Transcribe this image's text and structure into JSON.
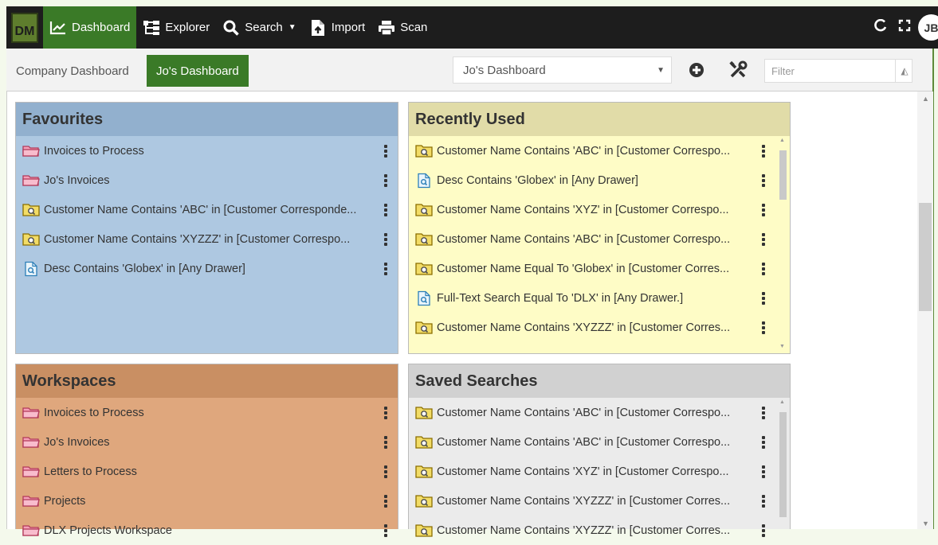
{
  "app": {
    "logo_text": "DM",
    "avatar_initials": "JB"
  },
  "nav": {
    "items": [
      {
        "label": "Dashboard",
        "icon": "line-chart-icon",
        "active": true
      },
      {
        "label": "Explorer",
        "icon": "tree-icon"
      },
      {
        "label": "Search",
        "icon": "search-icon",
        "dropdown": true
      },
      {
        "label": "Import",
        "icon": "file-import-icon"
      },
      {
        "label": "Scan",
        "icon": "printer-icon"
      }
    ],
    "right_icons": [
      "refresh-icon",
      "fullscreen-icon"
    ]
  },
  "toolbar": {
    "tabs": [
      {
        "label": "Company Dashboard",
        "active": false
      },
      {
        "label": "Jo's Dashboard",
        "active": true
      }
    ],
    "dashboard_select": "Jo's Dashboard",
    "filter_placeholder": "Filter"
  },
  "panels": {
    "favourites": {
      "title": "Favourites",
      "items": [
        {
          "type": "folder",
          "label": "Invoices to Process"
        },
        {
          "type": "folder",
          "label": "Jo's Invoices"
        },
        {
          "type": "search",
          "label": "Customer Name Contains 'ABC' in [Customer Corresponde..."
        },
        {
          "type": "search",
          "label": "Customer Name Contains 'XYZZZ' in [Customer Correspo..."
        },
        {
          "type": "doc",
          "label": "Desc Contains 'Globex' in [Any Drawer]"
        }
      ]
    },
    "recent": {
      "title": "Recently Used",
      "items": [
        {
          "type": "search",
          "label": "Customer Name Contains 'ABC' in [Customer Correspo..."
        },
        {
          "type": "doc",
          "label": "Desc Contains 'Globex' in [Any Drawer]"
        },
        {
          "type": "search",
          "label": "Customer Name Contains 'XYZ' in [Customer Correspo..."
        },
        {
          "type": "search",
          "label": "Customer Name Contains 'ABC' in [Customer Correspo..."
        },
        {
          "type": "search",
          "label": "Customer Name Equal To 'Globex' in [Customer Corres..."
        },
        {
          "type": "doc",
          "label": "Full-Text Search Equal To 'DLX' in [Any Drawer.]"
        },
        {
          "type": "search",
          "label": "Customer Name Contains 'XYZZZ' in [Customer Corres..."
        }
      ]
    },
    "workspaces": {
      "title": "Workspaces",
      "items": [
        {
          "type": "folder",
          "label": "Invoices to Process"
        },
        {
          "type": "folder",
          "label": "Jo's Invoices"
        },
        {
          "type": "folder",
          "label": "Letters to Process"
        },
        {
          "type": "folder",
          "label": "Projects"
        },
        {
          "type": "folder",
          "label": "DLX Projects Workspace"
        }
      ]
    },
    "saved": {
      "title": "Saved Searches",
      "items": [
        {
          "type": "search",
          "label": "Customer Name Contains 'ABC' in [Customer Correspo..."
        },
        {
          "type": "search",
          "label": "Customer Name Contains 'ABC' in [Customer Correspo..."
        },
        {
          "type": "search",
          "label": "Customer Name Contains 'XYZ' in [Customer Correspo..."
        },
        {
          "type": "search",
          "label": "Customer Name Contains 'XYZZZ' in [Customer Corres..."
        },
        {
          "type": "search",
          "label": "Customer Name Contains 'XYZZZ' in [Customer Corres..."
        }
      ]
    }
  },
  "colors": {
    "nav_bg": "#1d1d1d",
    "active_green": "#3a7a27",
    "favourites_bg": "#aec8e1",
    "recent_bg": "#fefcc6",
    "workspaces_bg": "#dfa77d",
    "saved_bg": "#ebebeb",
    "folder_pink": "#f5a0b8",
    "search_yellow": "#e8c93b",
    "doc_blue": "#2c7fb8"
  }
}
